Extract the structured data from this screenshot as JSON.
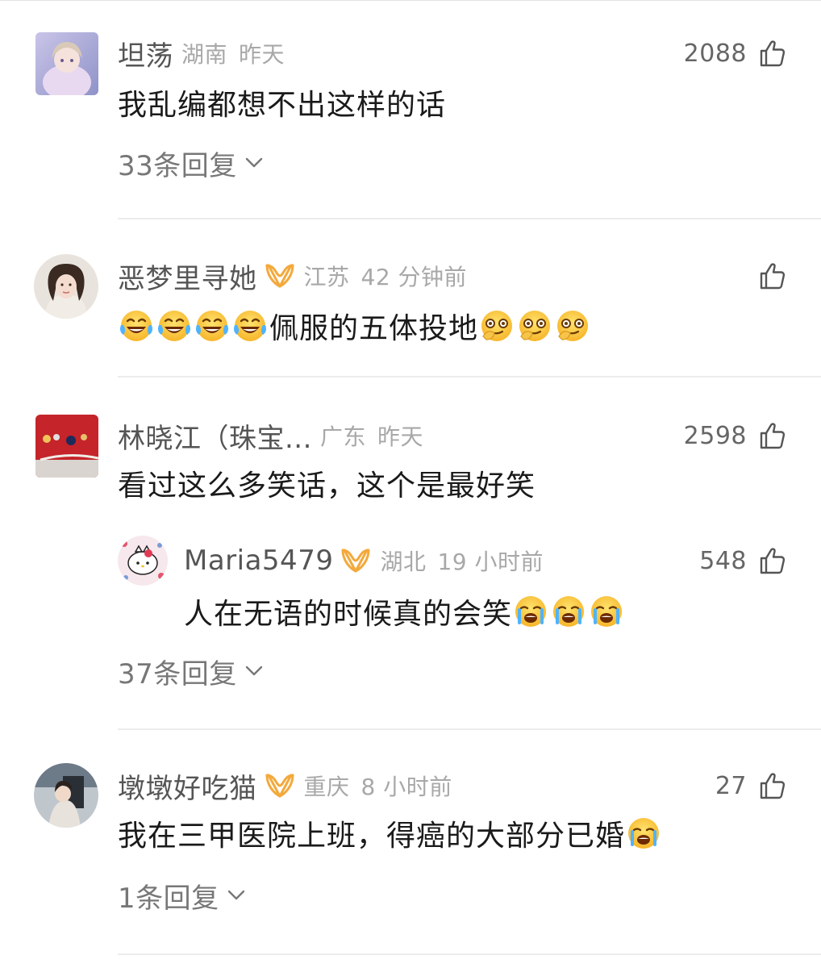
{
  "comments": [
    {
      "name": "坦荡",
      "location": "湖南",
      "time": "昨天",
      "likes": "2088",
      "text": "我乱编都想不出这样的话",
      "replies_label": "33条回复"
    },
    {
      "name": "恶梦里寻她",
      "location": "江苏",
      "time": "42 分钟前",
      "likes": "",
      "text": "佩服的五体投地",
      "emoji_before": [
        "laugh-cry",
        "laugh-cry",
        "laugh-cry",
        "laugh-cry"
      ],
      "emoji_after": [
        "monocle",
        "monocle",
        "monocle"
      ]
    },
    {
      "name": "林晓江（珠宝...",
      "location": "广东",
      "time": "昨天",
      "likes": "2598",
      "text": "看过这么多笑话，这个是最好笑",
      "reply": {
        "name": "Maria5479",
        "location": "湖北",
        "time": "19 小时前",
        "likes": "548",
        "text": "人在无语的时候真的会笑",
        "emoji_after": [
          "sob-laugh",
          "sob-laugh",
          "sob-laugh"
        ]
      },
      "replies_label": "37条回复"
    },
    {
      "name": "墩墩好吃猫",
      "location": "重庆",
      "time": "8 小时前",
      "likes": "27",
      "text": "我在三甲医院上班，得癌的大部分已婚",
      "emoji_after": [
        "sob-laugh"
      ],
      "replies_label": "1条回复"
    }
  ],
  "colors": {
    "vip_badge": "#f3a93c",
    "meta_gray": "#a8a8a8",
    "name_gray": "#555555"
  }
}
